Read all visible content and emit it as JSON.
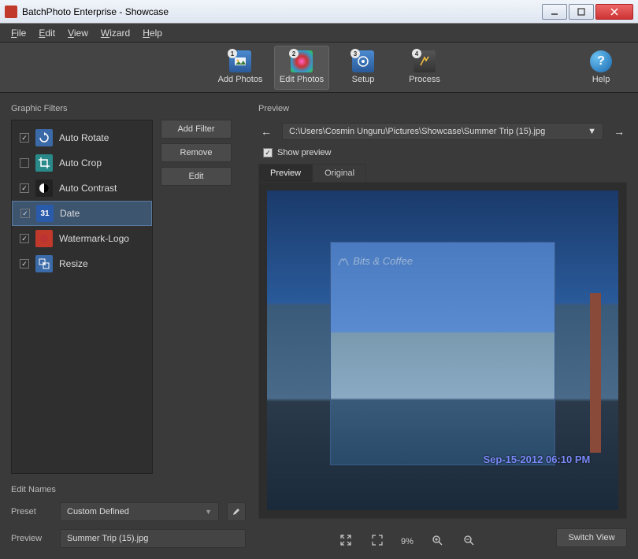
{
  "window": {
    "title": "BatchPhoto Enterprise - Showcase"
  },
  "menu": {
    "file": "File",
    "edit": "Edit",
    "view": "View",
    "wizard": "Wizard",
    "help": "Help"
  },
  "toolbar": {
    "add": "Add Photos",
    "edit": "Edit Photos",
    "setup": "Setup",
    "process": "Process",
    "help": "Help",
    "step1": "1",
    "step2": "2",
    "step3": "3",
    "step4": "4"
  },
  "left": {
    "filters_label": "Graphic Filters",
    "filters": [
      {
        "label": "Auto Rotate",
        "checked": true,
        "icon": "rotate",
        "color": "#3a6aa8"
      },
      {
        "label": "Auto Crop",
        "checked": false,
        "icon": "crop",
        "color": "#2a8a8a"
      },
      {
        "label": "Auto Contrast",
        "checked": true,
        "icon": "contrast",
        "color": "#222222"
      },
      {
        "label": "Date",
        "checked": true,
        "icon": "date",
        "color": "#2a5aaa"
      },
      {
        "label": "Watermark-Logo",
        "checked": true,
        "icon": "watermark",
        "color": "#c0392b"
      },
      {
        "label": "Resize",
        "checked": true,
        "icon": "resize",
        "color": "#3a6aa8"
      }
    ],
    "selected_index": 3,
    "btn_add": "Add Filter",
    "btn_remove": "Remove",
    "btn_edit": "Edit",
    "editnames_label": "Edit Names",
    "preset_label": "Preset",
    "preset_value": "Custom Defined",
    "preview_label": "Preview",
    "preview_value": "Summer Trip (15).jpg"
  },
  "right": {
    "preview_label": "Preview",
    "path": "C:\\Users\\Cosmin Unguru\\Pictures\\Showcase\\Summer Trip (15).jpg",
    "show_preview": "Show preview",
    "tab_preview": "Preview",
    "tab_original": "Original",
    "watermark_text": "Bits & Coffee",
    "date_stamp": "Sep-15-2012 06:10 PM",
    "zoom_pct": "9%",
    "switch_view": "Switch View"
  }
}
